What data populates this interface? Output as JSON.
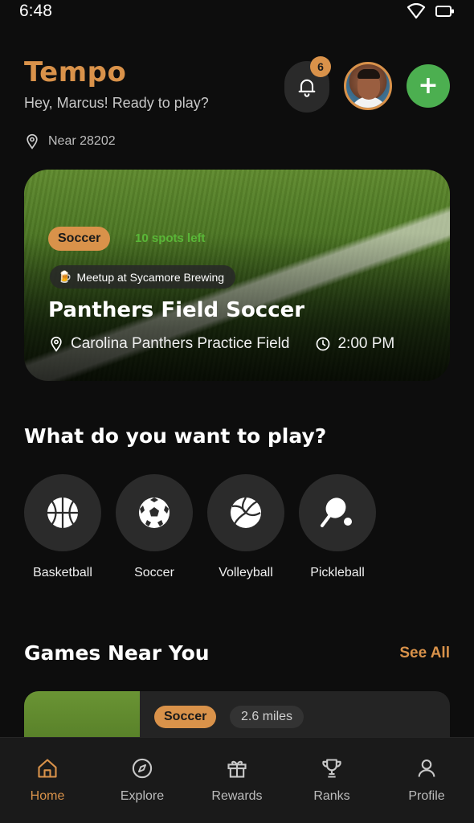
{
  "status_bar": {
    "time": "6:48"
  },
  "header": {
    "app_title": "Tempo",
    "greeting": "Hey, Marcus! Ready to play?",
    "notification_count": "6",
    "add_label": "+"
  },
  "location": {
    "label": "Near 28202"
  },
  "featured_game": {
    "sport": "Soccer",
    "spots": "10 spots left",
    "meetup": "Meetup at Sycamore Brewing",
    "title": "Panthers Field Soccer",
    "venue": "Carolina Panthers Practice Field",
    "time": "2:00 PM"
  },
  "sports_section": {
    "title": "What do you want to play?",
    "items": [
      {
        "label": "Basketball",
        "icon": "basketball-icon"
      },
      {
        "label": "Soccer",
        "icon": "soccer-ball-icon"
      },
      {
        "label": "Volleyball",
        "icon": "volleyball-icon"
      },
      {
        "label": "Pickleball",
        "icon": "pickleball-icon"
      }
    ]
  },
  "nearby": {
    "title": "Games Near You",
    "see_all": "See All",
    "games": [
      {
        "sport": "Soccer",
        "distance": "2.6 miles"
      }
    ]
  },
  "bottom_nav": {
    "items": [
      {
        "label": "Home",
        "icon": "home-icon",
        "active": true
      },
      {
        "label": "Explore",
        "icon": "compass-icon",
        "active": false
      },
      {
        "label": "Rewards",
        "icon": "gift-icon",
        "active": false
      },
      {
        "label": "Ranks",
        "icon": "trophy-icon",
        "active": false
      },
      {
        "label": "Profile",
        "icon": "person-icon",
        "active": false
      }
    ]
  },
  "colors": {
    "accent": "#d9924a",
    "add_button": "#4caf50",
    "background": "#0d0d0d",
    "spots_text": "#5cbf3a"
  }
}
